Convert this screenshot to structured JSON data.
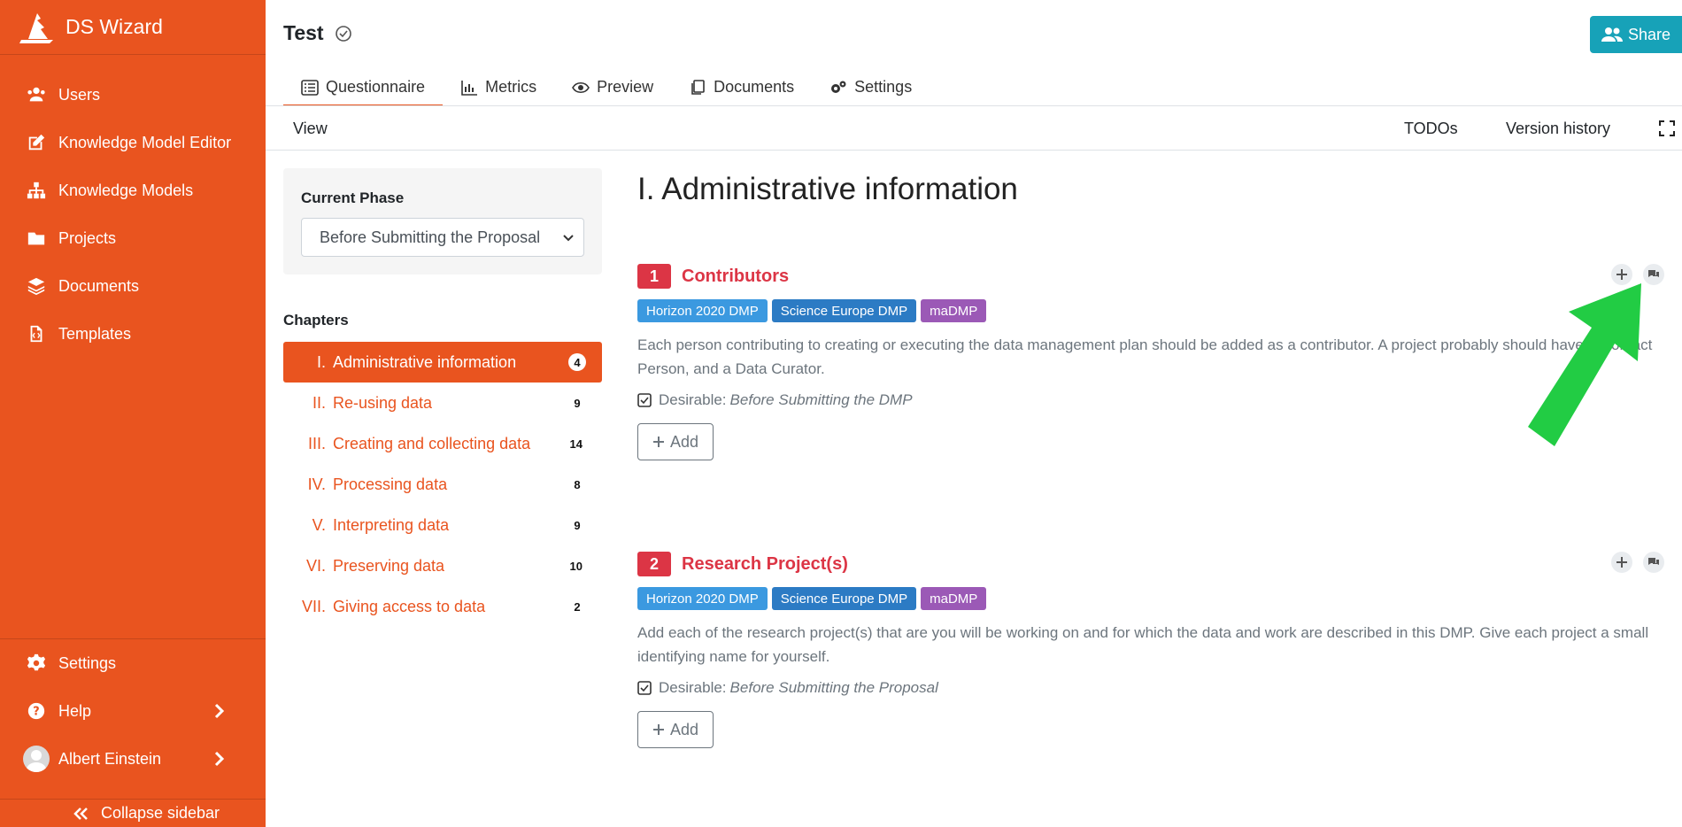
{
  "brand": {
    "name": "DS Wizard"
  },
  "sidebar": {
    "items": [
      {
        "label": "Users",
        "icon": "users-icon"
      },
      {
        "label": "Knowledge Model Editor",
        "icon": "edit-icon"
      },
      {
        "label": "Knowledge Models",
        "icon": "sitemap-icon"
      },
      {
        "label": "Projects",
        "icon": "folder-icon"
      },
      {
        "label": "Documents",
        "icon": "layers-icon"
      },
      {
        "label": "Templates",
        "icon": "file-code-icon"
      }
    ],
    "bottom": {
      "settings": "Settings",
      "help": "Help",
      "user": "Albert Einstein",
      "collapse": "Collapse sidebar"
    }
  },
  "header": {
    "title": "Test",
    "share": "Share",
    "tabs": [
      {
        "label": "Questionnaire",
        "active": true
      },
      {
        "label": "Metrics"
      },
      {
        "label": "Preview"
      },
      {
        "label": "Documents"
      },
      {
        "label": "Settings"
      }
    ]
  },
  "toolbar": {
    "view": "View",
    "todos": "TODOs",
    "history": "Version history"
  },
  "phase": {
    "label": "Current Phase",
    "selected": "Before Submitting the Proposal"
  },
  "chapters": {
    "label": "Chapters",
    "items": [
      {
        "num": "I.",
        "title": "Administrative information",
        "count": "4"
      },
      {
        "num": "II.",
        "title": "Re-using data",
        "count": "9"
      },
      {
        "num": "III.",
        "title": "Creating and collecting data",
        "count": "14"
      },
      {
        "num": "IV.",
        "title": "Processing data",
        "count": "8"
      },
      {
        "num": "V.",
        "title": "Interpreting data",
        "count": "9"
      },
      {
        "num": "VI.",
        "title": "Preserving data",
        "count": "10"
      },
      {
        "num": "VII.",
        "title": "Giving access to data",
        "count": "2"
      }
    ]
  },
  "content": {
    "chapter_title": "I. Administrative information",
    "questions": [
      {
        "num": "1",
        "title": "Contributors",
        "tags": [
          "Horizon 2020 DMP",
          "Science Europe DMP",
          "maDMP"
        ],
        "desc": "Each person contributing to creating or executing the data management plan should be added as a contributor. A project probably should have a Contact Person, and a Data Curator.",
        "desir_label": "Desirable:",
        "desir_value": "Before Submitting the DMP",
        "add": "Add"
      },
      {
        "num": "2",
        "title": "Research Project(s)",
        "tags": [
          "Horizon 2020 DMP",
          "Science Europe DMP",
          "maDMP"
        ],
        "desc": "Add each of the research project(s) that are you will be working on and for which the data and work are described in this DMP. Give each project a small identifying name for yourself.",
        "desir_label": "Desirable:",
        "desir_value": "Before Submitting the Proposal",
        "add": "Add"
      }
    ]
  },
  "colors": {
    "brand": "#e9541f",
    "danger": "#dc3545",
    "info": "#17a2b8",
    "tag_h2020": "#3b99e0",
    "tag_se": "#2c7bc4",
    "tag_madmp": "#9b59b6",
    "arrow": "#22cc44"
  }
}
